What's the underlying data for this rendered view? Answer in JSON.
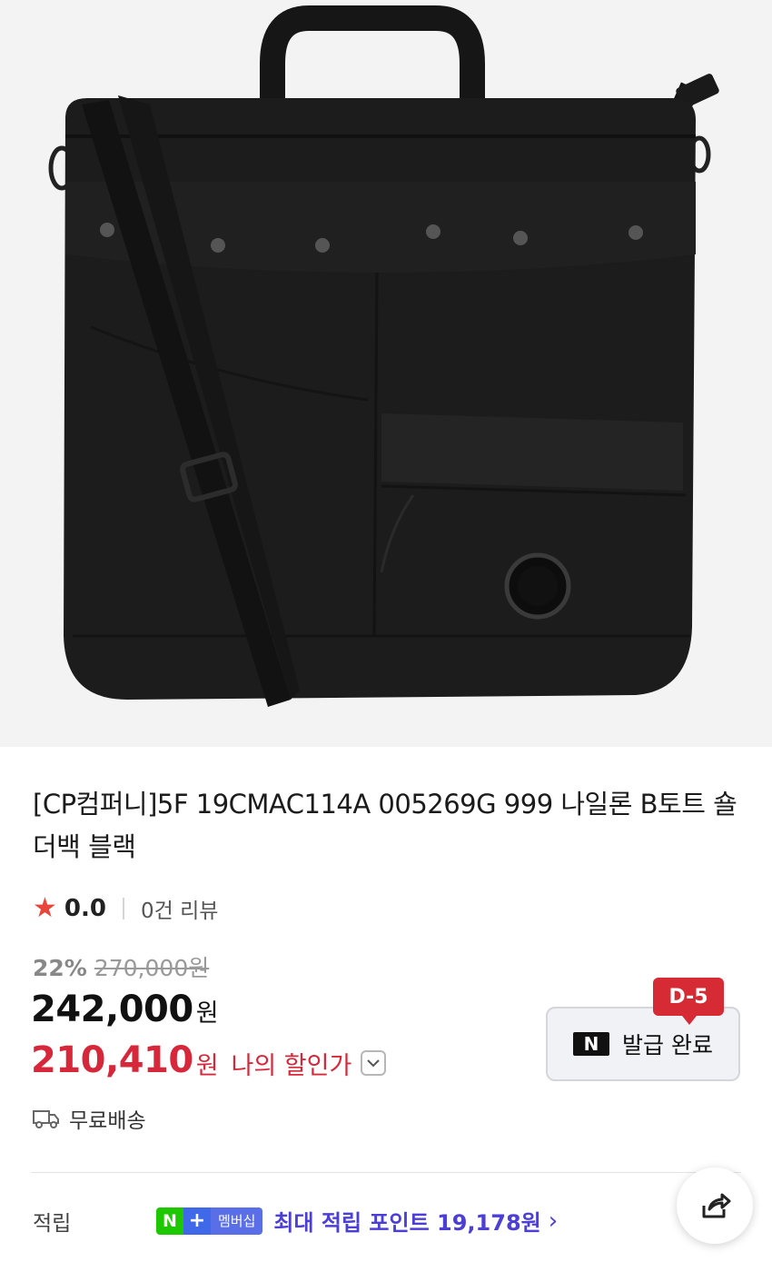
{
  "product": {
    "title": "[CP컴퍼니]5F 19CMAC114A 005269G 999 나일론 B토트 숄더백 블랙",
    "image_icon": "black-nylon-tote-bag-image"
  },
  "rating": {
    "score": "0.0",
    "reviews": "0건 리뷰"
  },
  "price": {
    "discount_rate": "22%",
    "original": "270,000원",
    "sale": "242,000",
    "sale_unit": "원",
    "my_price": "210,410",
    "my_price_unit": "원",
    "my_price_label": "나의 할인가"
  },
  "coupon": {
    "dday": "D-5",
    "logo": "N",
    "label": "발급 완료"
  },
  "shipping": {
    "label": "무료배송"
  },
  "points": {
    "label": "적립",
    "badge_n": "N",
    "badge_plus": "+",
    "badge_membership": "멤버십",
    "max_text": "최대 적립 포인트 19,178원"
  },
  "colors": {
    "accent_red": "#d6283a",
    "dday_red": "#d62b34",
    "naver_green": "#1ec800",
    "points_purple": "#4b3fd6"
  }
}
